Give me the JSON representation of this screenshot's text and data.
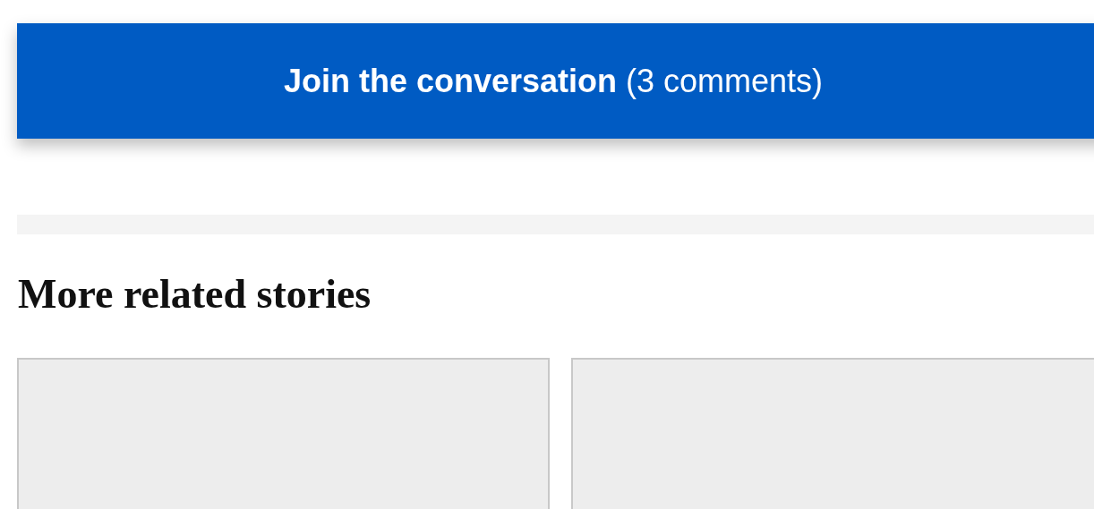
{
  "comments_button": {
    "label": "**Join the conversation** (3 comments)"
  },
  "related": {
    "title": "More related stories",
    "cards": [
      {
        "kind": "placeholder"
      },
      {
        "kind": "placeholder"
      }
    ]
  }
}
